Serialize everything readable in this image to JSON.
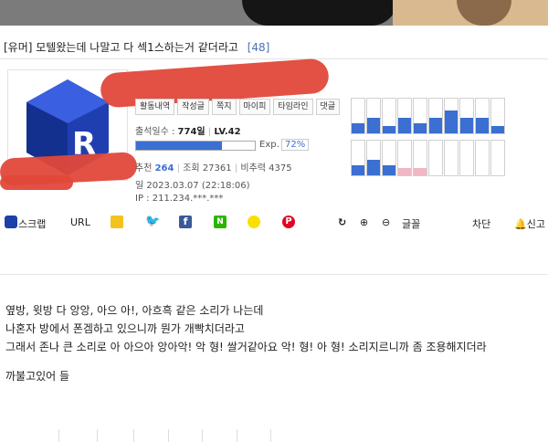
{
  "post": {
    "title_tag": "[유머]",
    "title": "모텔왔는데 나말고 다 섹1스하는거 같더라고",
    "comment_count": "[48]"
  },
  "profile": {
    "tabs": [
      "활동내역",
      "작성글",
      "쪽지",
      "마이피",
      "타임라인",
      "댓글"
    ],
    "attendance_label": "출석일수 :",
    "attendance_value": "774일",
    "level": "LV.42",
    "exp_label": "Exp.",
    "exp_percent": "72%",
    "exp_fraction": 0.72,
    "recommend_label": "추천",
    "recommend_value": "264",
    "views_label": "조회",
    "views_value": "27361",
    "disrecommend_label": "비추력",
    "disrecommend_value": "4375",
    "date_label": "일",
    "date": "2023.03.07 (22:18:06)",
    "ip_label": "IP :",
    "ip": "211.234.***.***",
    "activity_bars": [
      0.3,
      0.45,
      0.2,
      0.45,
      0.3,
      0.45,
      0.65,
      0.45,
      0.45,
      0.2,
      0.3,
      0.45,
      0.3,
      0.1,
      0.1,
      0.0,
      0.0,
      0.0,
      0.0,
      0.0
    ],
    "accent_color": "#3b6fd1",
    "pink_color": "#f0b8c4"
  },
  "toolbar": {
    "scrap_label": "스크랩",
    "url_label": "URL",
    "font_label": "글꼴",
    "block_label": "차단",
    "report_label": "신고",
    "icons": [
      "kakaostory-icon",
      "twitter-icon",
      "facebook-icon",
      "naver-band-icon",
      "kakaotalk-icon",
      "pinterest-icon",
      "refresh-icon",
      "zoom-in-icon",
      "zoom-out-icon",
      "bell-icon"
    ]
  },
  "content": {
    "lines": [
      "옆방, 윗방 다 앙앙, 아으 아!, 아흐흑 같은 소리가 나는데",
      "나혼자 방에서 폰겜하고 있으니까 뭔가 개빡치더라고",
      "그래서 존나 큰 소리로 아 아으아 앙아악! 악 형! 쌀거같아요 악! 형! 아 형! 소리지르니까 좀 조용해지더라",
      "",
      "까불고있어 들"
    ]
  }
}
